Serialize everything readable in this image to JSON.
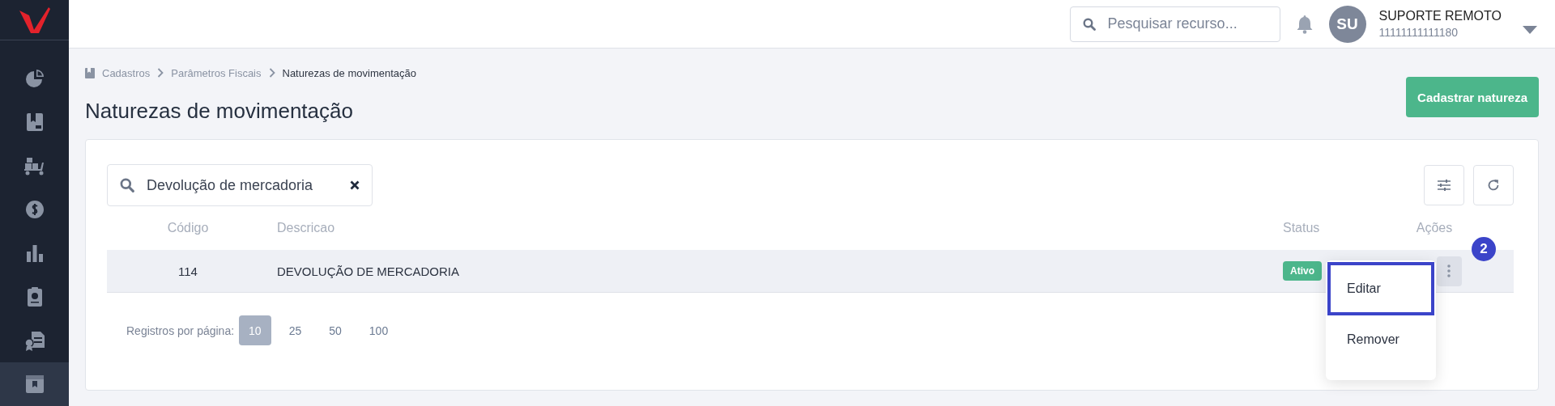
{
  "sidebar": {
    "items": [
      {
        "selected": false
      },
      {
        "selected": false
      },
      {
        "selected": false
      },
      {
        "selected": false
      },
      {
        "selected": false
      },
      {
        "selected": false
      },
      {
        "selected": false
      },
      {
        "selected": true
      }
    ]
  },
  "topbar": {
    "search": {
      "placeholder": "Pesquisar recurso..."
    },
    "user": {
      "initials": "SU",
      "name": "SUPORTE REMOTO",
      "id": "11111111111180"
    }
  },
  "breadcrumb": [
    "Cadastros",
    "Parâmetros Fiscais",
    "Naturezas de movimentação"
  ],
  "page_title": "Naturezas de movimentação",
  "primary_button": "Cadastrar natureza",
  "filter": {
    "value": "Devolução de mercadoria"
  },
  "table": {
    "columns": [
      "Código",
      "Descricao",
      "Status",
      "Ações"
    ],
    "rows": [
      {
        "code": "114",
        "description": "DEVOLUÇÃO DE MERCADORIA",
        "status": "Ativo",
        "active": true
      }
    ]
  },
  "action_menu": {
    "step_badge": "2",
    "items": [
      {
        "label": "Editar",
        "selected": true
      },
      {
        "label": "Remover",
        "selected": false
      }
    ]
  },
  "pagination": {
    "label": "Registros por página:",
    "sizes": [
      {
        "label": "10",
        "selected": true
      },
      {
        "label": "25",
        "selected": false
      },
      {
        "label": "50",
        "selected": false
      },
      {
        "label": "100",
        "selected": false
      }
    ]
  }
}
